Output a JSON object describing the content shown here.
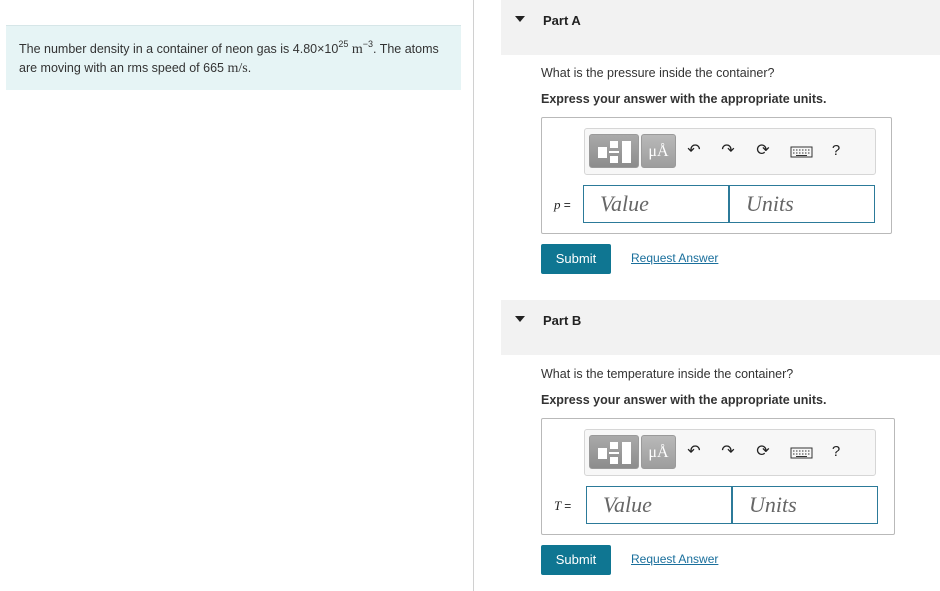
{
  "problem": {
    "text_before": "The number density in a container of neon gas is 4.80×10",
    "density_exponent": "25",
    "density_unit": "m",
    "unit_exponent": "−3",
    "text_middle": ". The atoms are moving with an rms speed of 665 ",
    "speed_unit": "m/s",
    "text_end": "."
  },
  "toolbar": {
    "units_label": "μÅ",
    "undo_icon": "↶",
    "redo_icon": "↷",
    "reset_icon": "⟳",
    "help_label": "?"
  },
  "parts": [
    {
      "title": "Part A",
      "question": "What is the pressure inside the container?",
      "instruction": "Express your answer with the appropriate units.",
      "variable": "p",
      "equals": "=",
      "value_placeholder": "Value",
      "units_placeholder": "Units",
      "submit_label": "Submit",
      "request_label": "Request Answer"
    },
    {
      "title": "Part B",
      "question": "What is the temperature inside the container?",
      "instruction": "Express your answer with the appropriate units.",
      "variable": "T",
      "equals": "=",
      "value_placeholder": "Value",
      "units_placeholder": "Units",
      "submit_label": "Submit",
      "request_label": "Request Answer"
    }
  ]
}
